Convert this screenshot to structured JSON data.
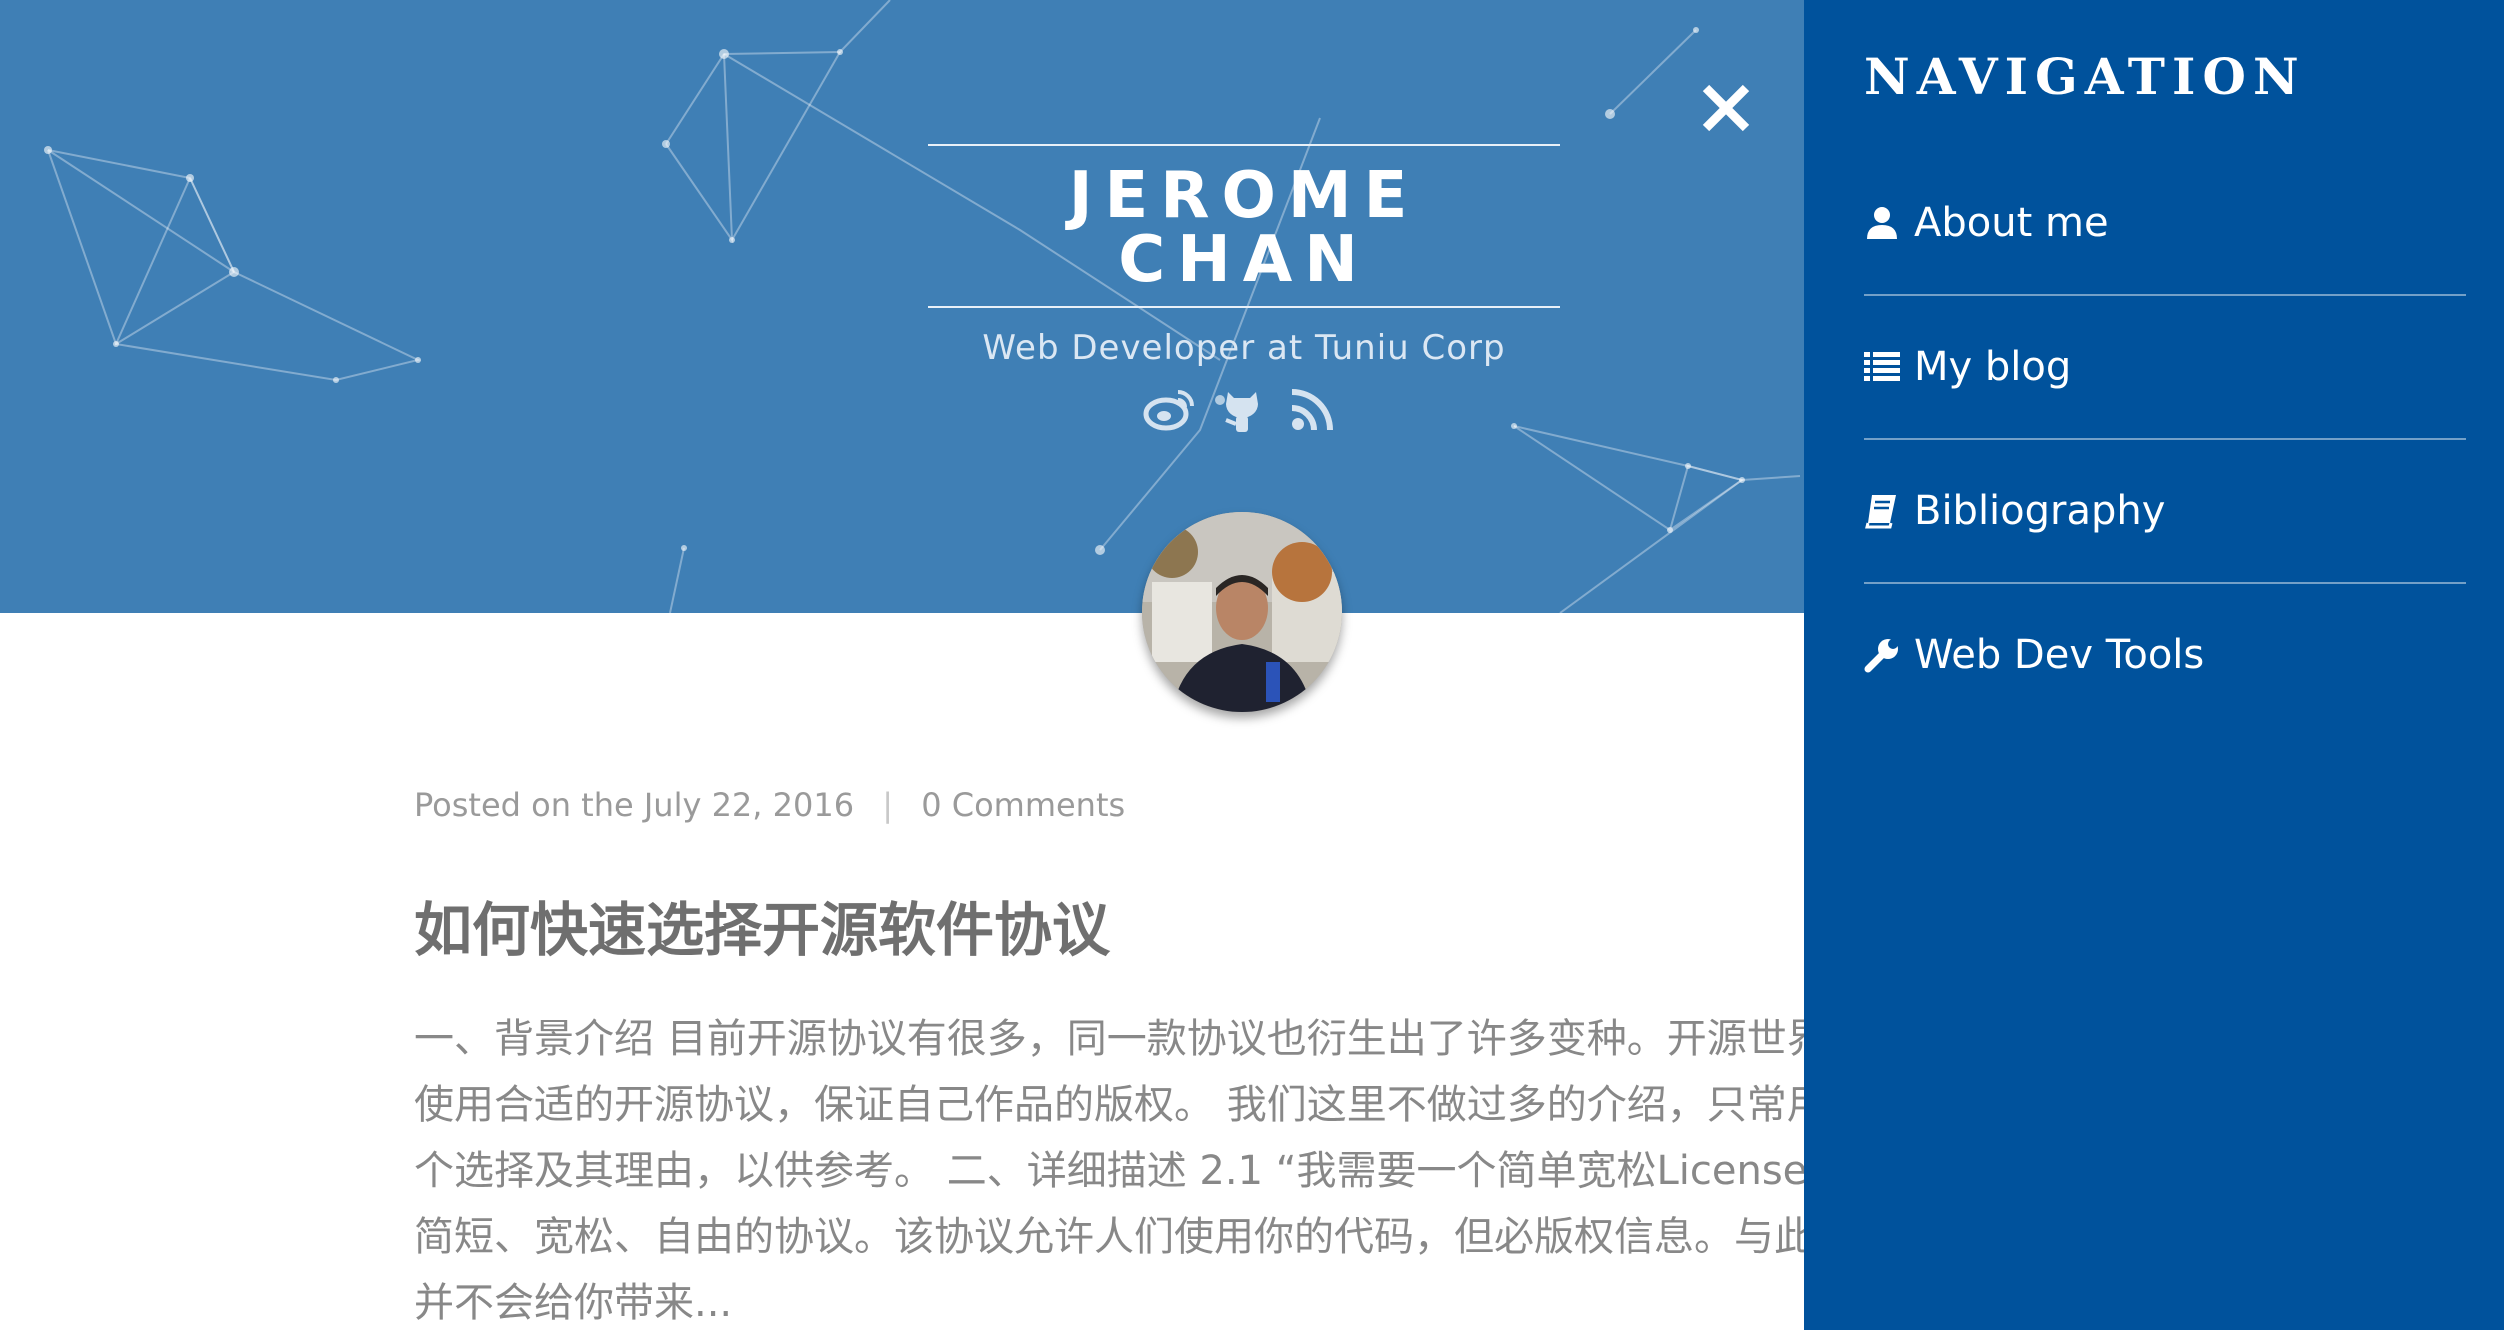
{
  "header": {
    "title": "JEROME CHAN",
    "subtitle": "Web Developer at Tuniu Corp",
    "social_icons": [
      "weibo-icon",
      "github-icon",
      "rss-icon"
    ]
  },
  "post": {
    "meta_prefix": "Posted on the July 22, 2016",
    "separator": "|",
    "comments": "0 Comments",
    "title": "如何快速选择开源软件协议",
    "excerpt": "一、背景介绍 目前开源协议有很多，同一款协议也衍生出了许多变种。开源世界可以使用合适的开源协议，保证自己作品的版权。 我们这里不做过多的介绍，只常用的三个选择及其理由，以供参考。 二、详细描述 2.1 “我需要一个简单宽松License是一个简短、宽松、自由的协议。该协议允许人们使用你的代码，但必版权信息。与此同时，并不会给你带来..."
  },
  "navigation": {
    "title": "NAVIGATION",
    "close_icon": "close-icon",
    "items": [
      {
        "icon": "user-icon",
        "label": "About me"
      },
      {
        "icon": "list-icon",
        "label": "My blog"
      },
      {
        "icon": "book-icon",
        "label": "Bibliography"
      },
      {
        "icon": "wrench-icon",
        "label": "Web Dev Tools"
      }
    ]
  },
  "colors": {
    "hero": "#3f7fb5",
    "drawer": "#00529c",
    "text_muted": "#888888"
  }
}
